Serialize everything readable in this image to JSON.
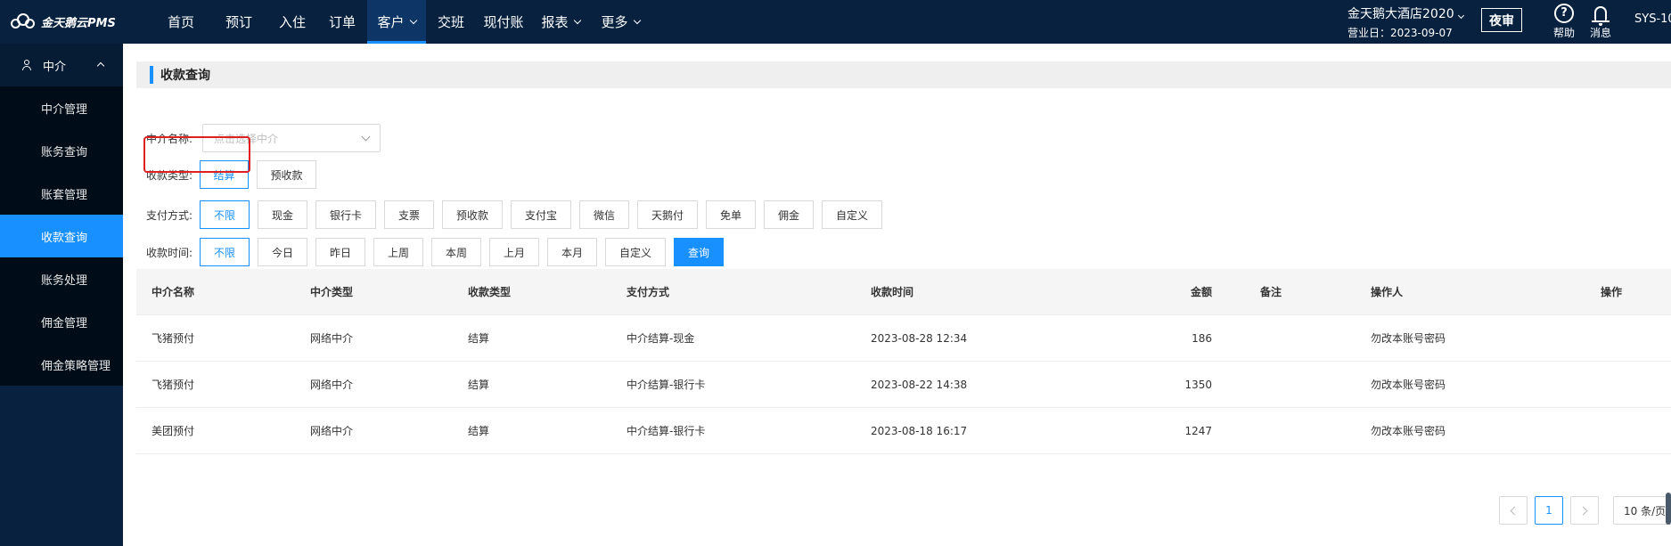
{
  "app": {
    "logo_text": "金天鹅云PMS"
  },
  "nav": {
    "items": [
      {
        "label": "首页",
        "has_dropdown": false,
        "active": false
      },
      {
        "label": "预订",
        "has_dropdown": false,
        "active": false
      },
      {
        "label": "入住",
        "has_dropdown": false,
        "active": false
      },
      {
        "label": "订单",
        "has_dropdown": false,
        "active": false
      },
      {
        "label": "客户",
        "has_dropdown": true,
        "active": true
      },
      {
        "label": "交班",
        "has_dropdown": false,
        "active": false
      },
      {
        "label": "现付账",
        "has_dropdown": false,
        "active": false
      },
      {
        "label": "报表",
        "has_dropdown": true,
        "active": false
      },
      {
        "label": "更多",
        "has_dropdown": true,
        "active": false
      }
    ]
  },
  "header": {
    "hotel_name": "金天鹅大酒店2020",
    "business_date": "营业日：2023-09-07",
    "night_audit": "夜审",
    "help": "帮助",
    "messages": "消息",
    "sys_code": "SYS-10"
  },
  "sidebar": {
    "group": "中介",
    "items": [
      {
        "label": "中介管理",
        "active": false
      },
      {
        "label": "账务查询",
        "active": false
      },
      {
        "label": "账套管理",
        "active": false
      },
      {
        "label": "收款查询",
        "active": true
      },
      {
        "label": "账务处理",
        "active": false
      },
      {
        "label": "佣金管理",
        "active": false
      },
      {
        "label": "佣金策略管理",
        "active": false
      }
    ]
  },
  "main": {
    "title": "收款查询",
    "filters": {
      "agent_label": "中介名称:",
      "agent_placeholder": "点击选择中介",
      "receipt_type_label": "收款类型:",
      "receipt_types": [
        "结算",
        "预收款"
      ],
      "payment_label": "支付方式:",
      "payments": [
        "不限",
        "现金",
        "银行卡",
        "支票",
        "预收款",
        "支付宝",
        "微信",
        "天鹅付",
        "免单",
        "佣金",
        "自定义"
      ],
      "time_label": "收款时间:",
      "times": [
        "不限",
        "今日",
        "昨日",
        "上周",
        "本周",
        "上月",
        "本月",
        "自定义"
      ],
      "query": "查询"
    },
    "table": {
      "headers": [
        "中介名称",
        "中介类型",
        "收款类型",
        "支付方式",
        "收款时间",
        "金额",
        "备注",
        "操作人",
        "操作"
      ],
      "rows": [
        [
          "飞猪预付",
          "网络中介",
          "结算",
          "中介结算-现金",
          "2023-08-28 12:34",
          "186",
          "",
          "勿改本账号密码",
          ""
        ],
        [
          "飞猪预付",
          "网络中介",
          "结算",
          "中介结算-银行卡",
          "2023-08-22 14:38",
          "1350",
          "",
          "勿改本账号密码",
          ""
        ],
        [
          "美团预付",
          "网络中介",
          "结算",
          "中介结算-银行卡",
          "2023-08-18 16:17",
          "1247",
          "",
          "勿改本账号密码",
          ""
        ]
      ]
    },
    "pagination": {
      "current": "1",
      "page_size": "10 条/页"
    }
  }
}
